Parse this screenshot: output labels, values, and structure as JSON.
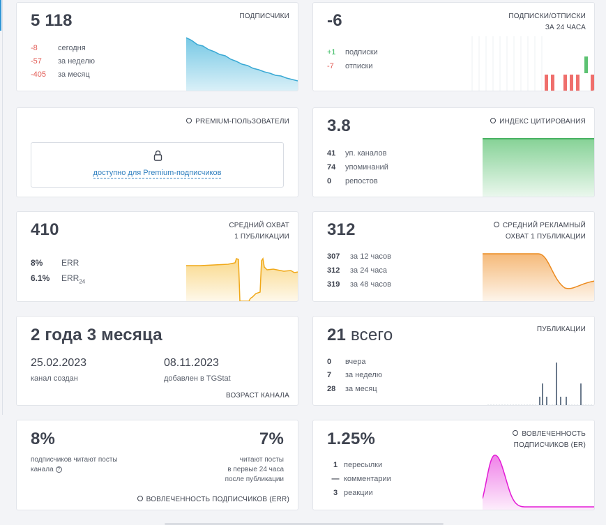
{
  "subscribers": {
    "value": "5 118",
    "header": "ПОДПИСЧИКИ",
    "rows": [
      {
        "value": "-8",
        "label": "сегодня"
      },
      {
        "value": "-57",
        "label": "за неделю"
      },
      {
        "value": "-405",
        "label": "за месяц"
      }
    ]
  },
  "subs_unsubs": {
    "value": "-6",
    "header1": "ПОДПИСКИ/ОТПИСКИ",
    "header2": "ЗА 24 ЧАСА",
    "rows": [
      {
        "value": "+1",
        "label": "подписки"
      },
      {
        "value": "-7",
        "label": "отписки"
      }
    ]
  },
  "premium": {
    "header": "PREMIUM-ПОЛЬЗОВАТЕЛИ",
    "link": "доступно для Premium-подписчиков"
  },
  "citation": {
    "value": "3.8",
    "header": "ИНДЕКС ЦИТИРОВАНИЯ",
    "rows": [
      {
        "value": "41",
        "label": "уп. каналов"
      },
      {
        "value": "74",
        "label": "упоминаний"
      },
      {
        "value": "0",
        "label": "репостов"
      }
    ]
  },
  "reach": {
    "value": "410",
    "header1": "СРЕДНИЙ ОХВАТ",
    "header2": "1 ПУБЛИКАЦИИ",
    "err": {
      "value": "8%",
      "label": "ERR"
    },
    "err24": {
      "value": "6.1%",
      "label": "ERR",
      "sub": "24"
    }
  },
  "ad_reach": {
    "value": "312",
    "header1": "СРЕДНИЙ РЕКЛАМНЫЙ",
    "header2": "ОХВАТ 1 ПУБЛИКАЦИИ",
    "rows": [
      {
        "value": "307",
        "label": "за 12 часов"
      },
      {
        "value": "312",
        "label": "за 24 часа"
      },
      {
        "value": "319",
        "label": "за 48 часов"
      }
    ]
  },
  "age": {
    "value": "2 года 3 месяца",
    "created_date": "25.02.2023",
    "created_label": "канал создан",
    "added_date": "08.11.2023",
    "added_label": "добавлен в TGStat",
    "footer": "ВОЗРАСТ КАНАЛА"
  },
  "publications": {
    "value_num": "21",
    "value_word": "всего",
    "header": "ПУБЛИКАЦИИ",
    "rows": [
      {
        "value": "0",
        "label": "вчера"
      },
      {
        "value": "7",
        "label": "за неделю"
      },
      {
        "value": "28",
        "label": "за месяц"
      }
    ]
  },
  "err_card": {
    "left_value": "8%",
    "left_label1": "подписчиков читают посты",
    "left_label2": "канала",
    "right_value": "7%",
    "right_label1": "читают посты",
    "right_label2": "в первые 24 часа",
    "right_label3": "после публикации",
    "footer": "ВОВЛЕЧЕННОСТЬ ПОДПИСЧИКОВ (ERR)"
  },
  "er_card": {
    "value": "1.25%",
    "header1": "ВОВЛЕЧЕННОСТЬ",
    "header2": "ПОДПИСЧИКОВ (ER)",
    "rows": [
      {
        "value": "1",
        "label": "пересылки"
      },
      {
        "value": "—",
        "label": "комментарии"
      },
      {
        "value": "3",
        "label": "реакции"
      }
    ]
  },
  "colors": {
    "blue": "#49b6dc",
    "green": "#5cc272",
    "red": "#ef6f6c",
    "orange": "#f09532",
    "yellow": "#f5b92b",
    "gray_bar": "#6b7a8c",
    "magenta": "#e31bd6"
  },
  "icons": {
    "info": "info-circle-icon",
    "lock": "lock-icon",
    "help": "question-circle-icon"
  }
}
